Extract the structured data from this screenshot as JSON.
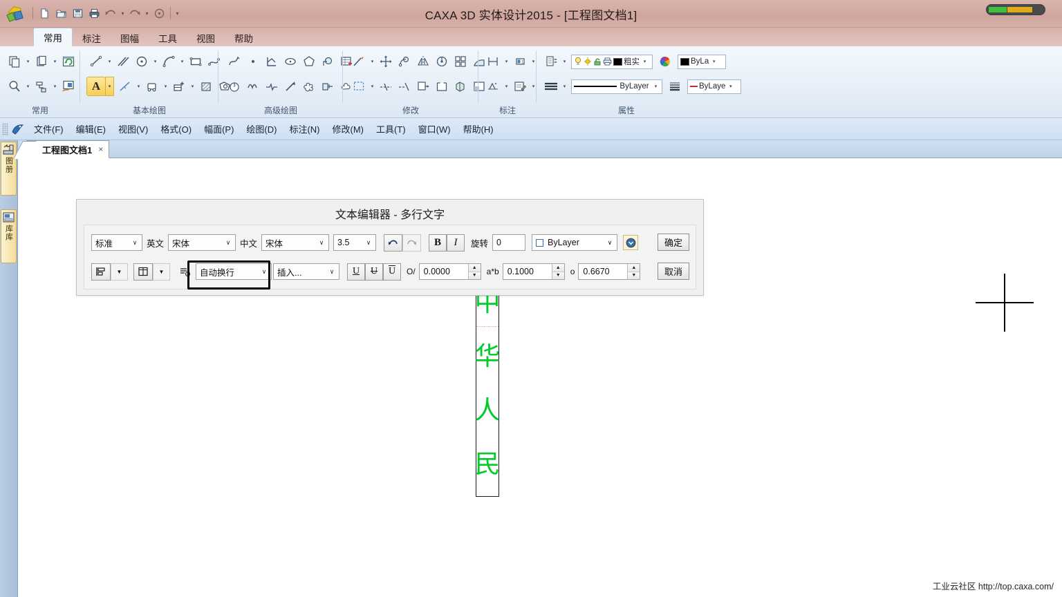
{
  "window": {
    "title": "CAXA 3D 实体设计2015 - [工程图文档1]"
  },
  "quick_access": {
    "items": [
      {
        "name": "new-icon",
        "label": "新建"
      },
      {
        "name": "open-icon",
        "label": "打开"
      },
      {
        "name": "save-icon",
        "label": "保存"
      },
      {
        "name": "print-icon",
        "label": "打印"
      },
      {
        "name": "undo-icon",
        "label": "撤销"
      },
      {
        "name": "redo-icon",
        "label": "重做"
      },
      {
        "name": "regen-icon",
        "label": "重生成"
      }
    ],
    "overflow_label": "▾"
  },
  "ribbon": {
    "tabs": [
      {
        "label": "常用",
        "active": true
      },
      {
        "label": "标注",
        "active": false
      },
      {
        "label": "图幅",
        "active": false
      },
      {
        "label": "工具",
        "active": false
      },
      {
        "label": "视图",
        "active": false
      },
      {
        "label": "帮助",
        "active": false
      }
    ],
    "groups": [
      {
        "label": "常用"
      },
      {
        "label": "基本绘图"
      },
      {
        "label": "高级绘图"
      },
      {
        "label": "修改"
      },
      {
        "label": "标注"
      },
      {
        "label": "属性"
      }
    ],
    "properties": {
      "layer_value": "粗实",
      "color_value": "ByLa",
      "linetype_value": "ByLayer",
      "lineweight_value": "ByLaye"
    }
  },
  "menubar": {
    "items": [
      "文件(F)",
      "编辑(E)",
      "视图(V)",
      "格式(O)",
      "幅面(P)",
      "绘图(D)",
      "标注(N)",
      "修改(M)",
      "工具(T)",
      "窗口(W)",
      "帮助(H)"
    ]
  },
  "left_dock": {
    "tabs": [
      {
        "name": "sidebar-tab-drawing-library",
        "label": "图册"
      },
      {
        "name": "sidebar-tab-part-library",
        "label": "库库"
      }
    ]
  },
  "document_tabs": [
    {
      "label": "工程图文档1",
      "close": "×",
      "active": true
    }
  ],
  "dialog": {
    "title": "文本编辑器 - 多行文字",
    "row1": {
      "style": "标准",
      "english_label": "英文",
      "english_font": "宋体",
      "chinese_label": "中文",
      "chinese_font": "宋体",
      "size": "3.5",
      "undo_icon": "undo-icon",
      "redo_icon": "redo-icon",
      "bold": "B",
      "italic": "I",
      "rotate_label": "旋转",
      "rotate_value": "0",
      "color_value": "ByLayer",
      "more_icon": "more-options-icon",
      "ok": "确定"
    },
    "row2": {
      "align_icon": "text-align-icon",
      "column_icon": "columns-icon",
      "settings_icon": "text-settings-icon",
      "wrap_mode": "自动换行",
      "insert": "插入...",
      "underline": "U",
      "strikethrough": "U",
      "overline": "U",
      "slant_label": "O/",
      "slant_value": "0.0000",
      "ratio_label": "a*b",
      "ratio_value": "0.1000",
      "spacing_label": "o",
      "spacing_value": "0.6670",
      "cancel": "取消"
    }
  },
  "canvas": {
    "vertical_text": [
      "中",
      "华",
      "人",
      "民"
    ],
    "text_color": "#00cc2a",
    "cursor": "crosshair"
  },
  "status": {
    "community_label": "工业云社区",
    "url": "http://top.caxa.com/"
  }
}
